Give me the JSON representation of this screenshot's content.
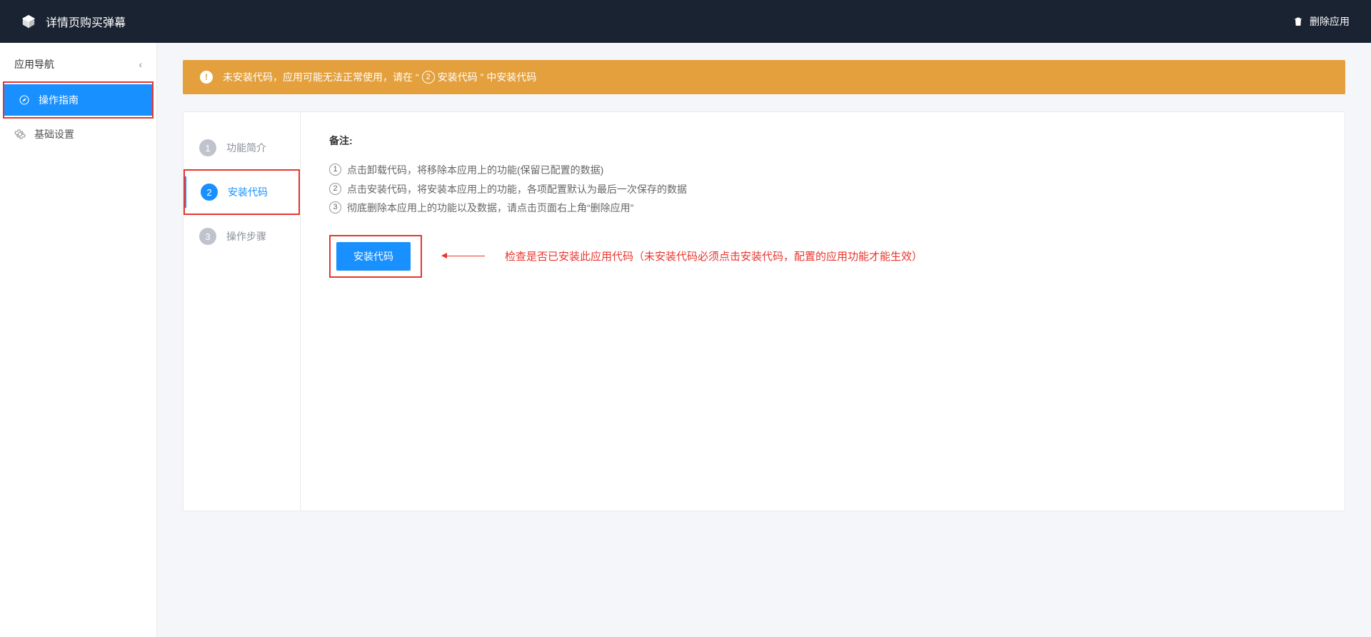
{
  "header": {
    "app_title": "详情页购买弹幕",
    "delete_btn": "删除应用"
  },
  "sidebar": {
    "title": "应用导航",
    "items": [
      {
        "label": "操作指南"
      },
      {
        "label": "基础设置"
      }
    ]
  },
  "alert": {
    "text_before": "未安装代码，应用可能无法正常使用，请在",
    "step_num": "②",
    "step_label": "安装代码",
    "text_after": "中安装代码"
  },
  "steps": [
    {
      "num": "1",
      "label": "功能简介"
    },
    {
      "num": "2",
      "label": "安装代码"
    },
    {
      "num": "3",
      "label": "操作步骤"
    }
  ],
  "content": {
    "note_title": "备注:",
    "notes": [
      "点击卸载代码，将移除本应用上的功能(保留已配置的数据)",
      "点击安装代码，将安装本应用上的功能，各项配置默认为最后一次保存的数据",
      "彻底删除本应用上的功能以及数据，请点击页面右上角“删除应用”"
    ],
    "install_btn": "安装代码",
    "annotation": "检查是否已安装此应用代码（未安装代码必须点击安装代码，配置的应用功能才能生效）"
  }
}
